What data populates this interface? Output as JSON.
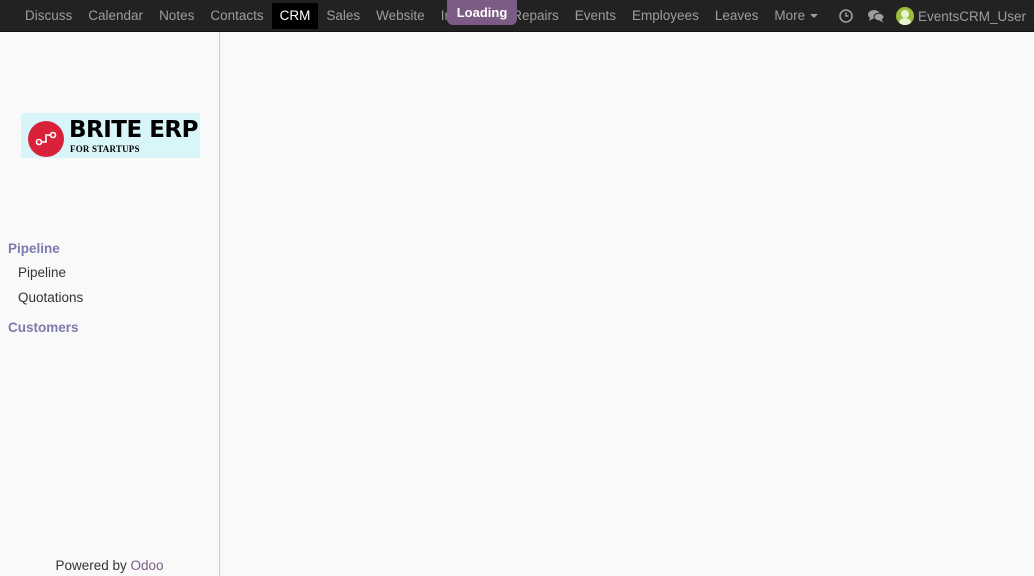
{
  "navbar": {
    "menu": [
      {
        "label": "Discuss",
        "active": false
      },
      {
        "label": "Calendar",
        "active": false
      },
      {
        "label": "Notes",
        "active": false
      },
      {
        "label": "Contacts",
        "active": false
      },
      {
        "label": "CRM",
        "active": true
      },
      {
        "label": "Sales",
        "active": false
      },
      {
        "label": "Website",
        "active": false
      },
      {
        "label": "Inventory",
        "active": false
      },
      {
        "label": "Repairs",
        "active": false
      },
      {
        "label": "Events",
        "active": false
      },
      {
        "label": "Employees",
        "active": false
      },
      {
        "label": "Leaves",
        "active": false
      }
    ],
    "more_label": "More",
    "loading_label": "Loading",
    "icons": {
      "activity": "clock-icon",
      "messaging": "chat-icon"
    },
    "user_name": "EventsCRM_User"
  },
  "sidebar": {
    "logo": {
      "title": "BRITE ERP",
      "subtitle": "FOR STARTUPS"
    },
    "sections": [
      {
        "title": "Pipeline",
        "items": [
          "Pipeline",
          "Quotations"
        ]
      },
      {
        "title": "Customers",
        "items": []
      }
    ],
    "footer": {
      "prefix": "Powered by",
      "brand": "Odoo"
    }
  },
  "colors": {
    "navbar_bg": "#222222",
    "active_item_bg": "#000000",
    "loading_bg": "#7c5c84",
    "section_title": "#7c7bad",
    "brand": "#7c5c84",
    "logo_bg": "#d8f6fa",
    "logo_badge": "#d9223a"
  }
}
